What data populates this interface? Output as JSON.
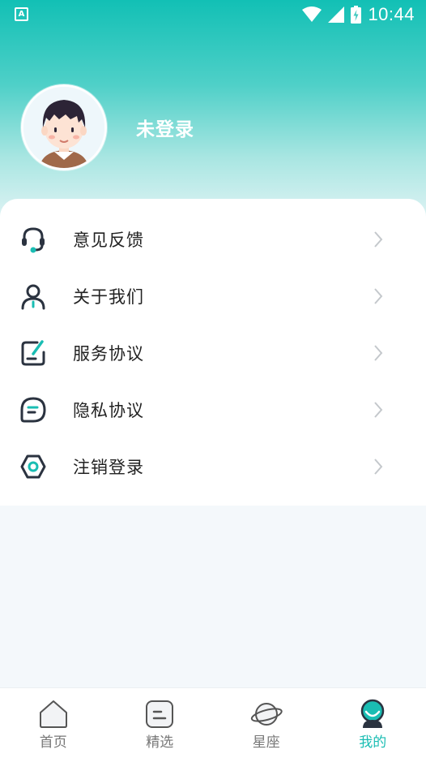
{
  "status_bar": {
    "app_icon_letter": "A",
    "time": "10:44"
  },
  "profile": {
    "username": "未登录"
  },
  "menu": {
    "items": [
      {
        "label": "意见反馈",
        "icon": "headset-icon"
      },
      {
        "label": "关于我们",
        "icon": "person-icon"
      },
      {
        "label": "服务协议",
        "icon": "edit-document-icon"
      },
      {
        "label": "隐私协议",
        "icon": "privacy-chat-icon"
      },
      {
        "label": "注销登录",
        "icon": "hexagon-logout-icon"
      }
    ]
  },
  "tabbar": {
    "tabs": [
      {
        "label": "首页",
        "icon": "home-icon",
        "active": false
      },
      {
        "label": "精选",
        "icon": "featured-list-icon",
        "active": false
      },
      {
        "label": "星座",
        "icon": "planet-icon",
        "active": false
      },
      {
        "label": "我的",
        "icon": "profile-icon",
        "active": true
      }
    ]
  },
  "colors": {
    "accent": "#1abdb3",
    "header_top": "#12c0b5",
    "page_bg": "#f4f8fb",
    "icon_dark": "#2b3340",
    "inactive_tab": "#777777"
  }
}
